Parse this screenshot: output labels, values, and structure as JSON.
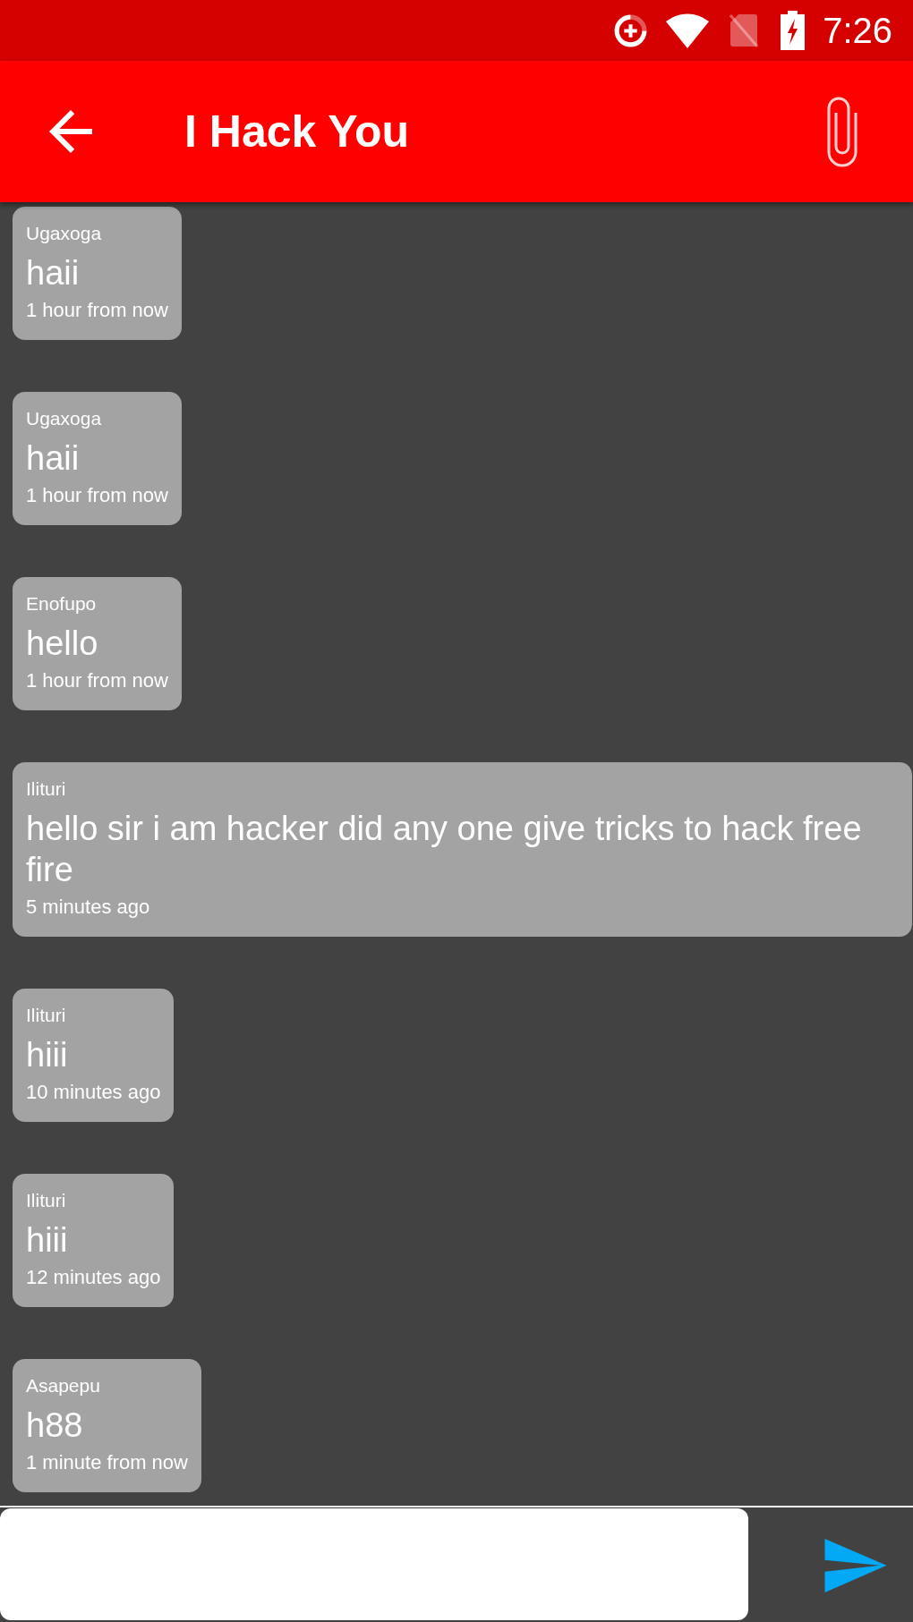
{
  "status_bar": {
    "time": "7:26"
  },
  "app_bar": {
    "title": "I Hack You"
  },
  "messages": [
    {
      "sender": "Ugaxoga",
      "text": "haii",
      "time": "1 hour from now"
    },
    {
      "sender": "Ugaxoga",
      "text": "haii",
      "time": "1 hour from now"
    },
    {
      "sender": "Enofupo",
      "text": "hello",
      "time": "1 hour from now"
    },
    {
      "sender": "Ilituri",
      "text": "hello sir i am hacker did any one give tricks to hack free fire",
      "time": "5 minutes ago"
    },
    {
      "sender": "Ilituri",
      "text": "hiii",
      "time": "10 minutes ago"
    },
    {
      "sender": "Ilituri",
      "text": "hiii",
      "time": "12 minutes ago"
    },
    {
      "sender": "Asapepu",
      "text": "h88",
      "time": "1 minute from now"
    }
  ]
}
